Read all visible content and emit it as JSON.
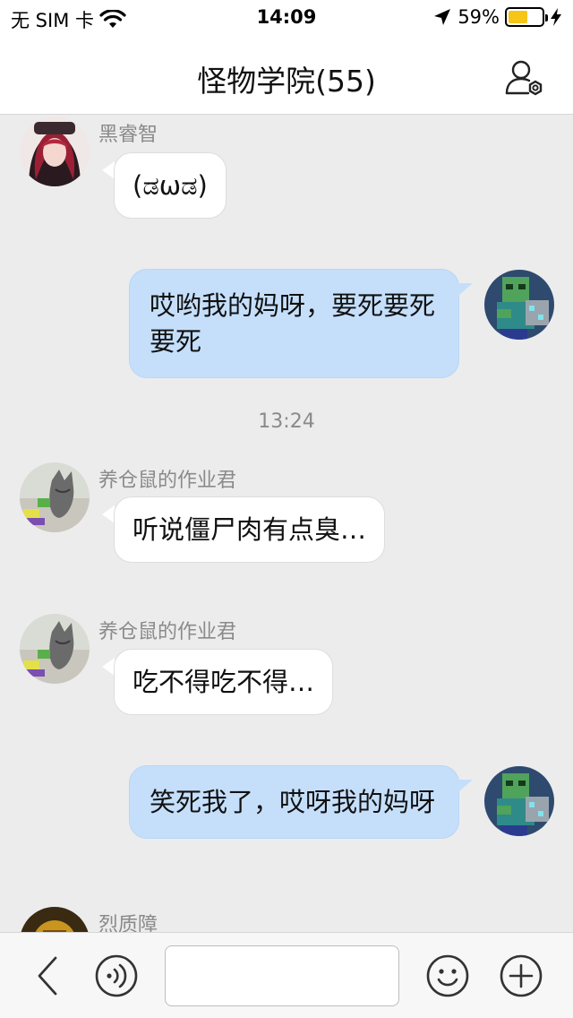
{
  "status_bar": {
    "carrier": "无 SIM 卡",
    "time": "14:09",
    "battery_percent": "59%",
    "battery_level": 0.59,
    "battery_color": "#f5c518"
  },
  "header": {
    "title": "怪物学院(55)",
    "settings_icon": "group-settings-icon"
  },
  "messages": [
    {
      "type": "incoming",
      "sender": "黑睿智",
      "text": "(ಡωಡ)"
    },
    {
      "type": "outgoing",
      "text": "哎哟我的妈呀，要死要死要死"
    },
    {
      "type": "timestamp",
      "text": "13:24"
    },
    {
      "type": "incoming",
      "sender": "养仓鼠的作业君",
      "text": "听说僵尸肉有点臭…"
    },
    {
      "type": "incoming",
      "sender": "养仓鼠的作业君",
      "text": "吃不得吃不得…"
    },
    {
      "type": "outgoing",
      "text": "笑死我了，哎呀我的妈呀"
    },
    {
      "type": "incoming",
      "sender": "烈质障",
      "text": ""
    }
  ],
  "input_bar": {
    "back_icon": "chevron-left-icon",
    "voice_icon": "voice-icon",
    "input_value": "",
    "emoji_icon": "emoji-icon",
    "plus_icon": "plus-icon"
  },
  "colors": {
    "outgoing_bubble": "#c5dffb",
    "incoming_bubble": "#ffffff",
    "background": "#ececed"
  }
}
